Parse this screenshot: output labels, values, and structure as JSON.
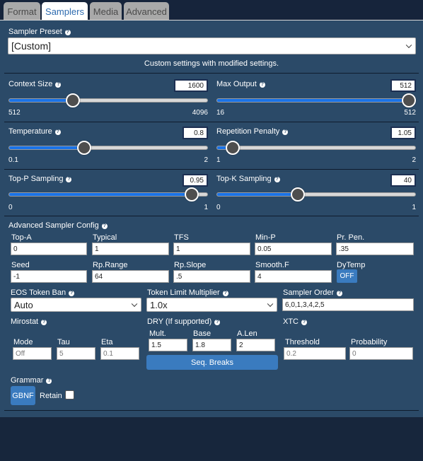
{
  "tabs": [
    {
      "label": "Format"
    },
    {
      "label": "Samplers"
    },
    {
      "label": "Media"
    },
    {
      "label": "Advanced"
    }
  ],
  "preset": {
    "label": "Sampler Preset",
    "value": "[Custom]",
    "description": "Custom settings with modified settings."
  },
  "sliders": {
    "context_size": {
      "label": "Context Size",
      "value": "1600",
      "min": "512",
      "max": "4096",
      "fraction": 0.31
    },
    "max_output": {
      "label": "Max Output",
      "value": "512",
      "min": "16",
      "max": "512",
      "fraction": 1.0
    },
    "temperature": {
      "label": "Temperature",
      "value": "0.8",
      "min": "0.1",
      "max": "2",
      "fraction": 0.37
    },
    "repetition_penalty": {
      "label": "Repetition Penalty",
      "value": "1.05",
      "min": "1",
      "max": "2",
      "fraction": 0.05
    },
    "top_p": {
      "label": "Top-P Sampling",
      "value": "0.95",
      "min": "0",
      "max": "1",
      "fraction": 0.95
    },
    "top_k": {
      "label": "Top-K Sampling",
      "value": "40",
      "min": "0",
      "max": "1",
      "fraction": 0.4
    }
  },
  "advanced": {
    "title": "Advanced Sampler Config",
    "fields": [
      {
        "label": "Top-A",
        "value": "0"
      },
      {
        "label": "Typical",
        "value": "1"
      },
      {
        "label": "TFS",
        "value": "1"
      },
      {
        "label": "Min-P",
        "value": "0.05"
      },
      {
        "label": "Pr. Pen.",
        "value": ".35"
      },
      {
        "label": "Seed",
        "value": "-1"
      },
      {
        "label": "Rp.Range",
        "value": "64"
      },
      {
        "label": "Rp.Slope",
        "value": ".5"
      },
      {
        "label": "Smooth.F",
        "value": "4"
      }
    ],
    "dytemp": {
      "label": "DyTemp",
      "value": "OFF"
    }
  },
  "eos": {
    "label": "EOS Token Ban",
    "value": "Auto"
  },
  "token_limit": {
    "label": "Token Limit Multiplier",
    "value": "1.0x"
  },
  "sampler_order": {
    "label": "Sampler Order",
    "value": "6,0,1,3,4,2,5"
  },
  "mirostat": {
    "label": "Mirostat",
    "mode_label": "Mode",
    "mode_value": "Off",
    "tau_label": "Tau",
    "tau_value": "5",
    "eta_label": "Eta",
    "eta_value": "0.1"
  },
  "dry": {
    "label": "DRY (If supported)",
    "mult_label": "Mult.",
    "mult_value": "1.5",
    "base_label": "Base",
    "base_value": "1.8",
    "alen_label": "A.Len",
    "alen_value": "2",
    "seq_breaks": "Seq. Breaks"
  },
  "xtc": {
    "label": "XTC",
    "threshold_label": "Threshold",
    "threshold_value": "0.2",
    "probability_label": "Probability",
    "probability_value": "0"
  },
  "grammar": {
    "label": "Grammar",
    "button": "GBNF",
    "retain_label": "Retain"
  },
  "colors": {
    "panel": "#2b4a68",
    "accent": "#1a73e8",
    "button": "#3a7bbf"
  }
}
